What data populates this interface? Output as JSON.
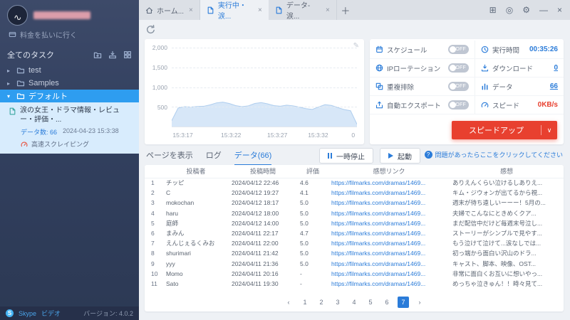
{
  "colors": {
    "accent": "#2b7cd9",
    "danger": "#e8402f",
    "chart_fill": "#d7e7f8",
    "chart_stroke": "#aecdee"
  },
  "icons": {
    "close": "×",
    "plus": "＋",
    "chevron_right": "▸",
    "chevron_down": "▾",
    "edit": "✎",
    "dropdown": "∨",
    "grid": "⊞",
    "circle": "◎",
    "gear": "⚙",
    "minimize": "—",
    "window_close": "×",
    "question": "?"
  },
  "sidebar": {
    "pay_link": "料金を払いに行く",
    "all_tasks_label": "全てのタスク",
    "folders": [
      {
        "label": "test"
      },
      {
        "label": "Samples"
      },
      {
        "label": "デフォルト"
      }
    ],
    "task": {
      "title": "涙の女王・ドラマ情報・レビュー・評価・...",
      "meta_count": "データ数: 66",
      "meta_time": "2024-04-23 15:3:38",
      "mode": "高速スクレイピング"
    },
    "footer": {
      "skype": "Skype",
      "video": "ビデオ",
      "version": "バージョン: 4.0.2"
    }
  },
  "tabs": {
    "items": [
      {
        "label": "ホーム..."
      },
      {
        "label": "実行中・涙..."
      },
      {
        "label": "データ-涙..."
      }
    ]
  },
  "stats": {
    "rows": [
      {
        "label": "スケジュール",
        "toggle": "OFF",
        "metric": "実行時間",
        "value": "00:35:26"
      },
      {
        "label": "IPローテーション",
        "toggle": "OFF",
        "metric": "ダウンロード",
        "value": "0"
      },
      {
        "label": "重複排除",
        "toggle": "OFF",
        "metric": "データ",
        "value": "66"
      },
      {
        "label": "自動エクスポート",
        "toggle": "OFF",
        "metric": "スピード",
        "value": "0KB/s"
      }
    ],
    "speedup_label": "スピードアップ"
  },
  "subtabs": {
    "items": [
      {
        "label": "ページを表示"
      },
      {
        "label": "ログ"
      },
      {
        "label": "データ(66)"
      }
    ]
  },
  "runbar": {
    "pause_label": "一時停止",
    "start_label": "起動"
  },
  "help": {
    "text": "問題があったらここをクリックしてください"
  },
  "table": {
    "headers": [
      "投稿者",
      "投稿時間",
      "評価",
      "感想リンク",
      "感想"
    ],
    "rows": [
      {
        "index": "1",
        "author": "チッピ",
        "time": "2024/04/12 22:46",
        "rating": "4.6",
        "link": "https://filmarks.com/dramas/1469...",
        "comment": "ありえんくらい泣けるしありえ..."
      },
      {
        "index": "2",
        "author": "C",
        "time": "2024/04/12 19:27",
        "rating": "4.1",
        "link": "https://filmarks.com/dramas/1469...",
        "comment": "キム・ジウォンが出てるから視..."
      },
      {
        "index": "3",
        "author": "mokochan",
        "time": "2024/04/12 18:17",
        "rating": "5.0",
        "link": "https://filmarks.com/dramas/1469...",
        "comment": "週末が待ち遠しいーーー！5月の..."
      },
      {
        "index": "4",
        "author": "haru",
        "time": "2024/04/12 18:00",
        "rating": "5.0",
        "link": "https://filmarks.com/dramas/1469...",
        "comment": "夫婦でこんなにときめくクア..."
      },
      {
        "index": "5",
        "author": "庭師",
        "time": "2024/04/12 14:00",
        "rating": "5.0",
        "link": "https://filmarks.com/dramas/1469...",
        "comment": "まだ配信中だけど毎週末号泣し..."
      },
      {
        "index": "6",
        "author": "まみん",
        "time": "2024/04/11 22:17",
        "rating": "4.7",
        "link": "https://filmarks.com/dramas/1469...",
        "comment": "ストーリーがシンプルで見やす..."
      },
      {
        "index": "7",
        "author": "えんじぇるくみお",
        "time": "2024/04/11 22:00",
        "rating": "5.0",
        "link": "https://filmarks.com/dramas/1469...",
        "comment": "もう泣けて泣けて...涙なしでは..."
      },
      {
        "index": "8",
        "author": "shurimari",
        "time": "2024/04/11 21:42",
        "rating": "5.0",
        "link": "https://filmarks.com/dramas/1469...",
        "comment": "初っ端から面白い沢山のドラ..."
      },
      {
        "index": "9",
        "author": "yyy",
        "time": "2024/04/11 21:36",
        "rating": "5.0",
        "link": "https://filmarks.com/dramas/1469...",
        "comment": "キャスト、脚本、映像、OST..."
      },
      {
        "index": "10",
        "author": "Momo",
        "time": "2024/04/11 20:16",
        "rating": "-",
        "link": "https://filmarks.com/dramas/1469...",
        "comment": "非常に面白くお互いに想いやっ..."
      },
      {
        "index": "11",
        "author": "Sato",
        "time": "2024/04/11 19:30",
        "rating": "-",
        "link": "https://filmarks.com/dramas/1469...",
        "comment": "めっちゃ泣きゅん！！時々見て..."
      }
    ]
  },
  "pagination": {
    "prev": "‹",
    "pages": [
      "1",
      "2",
      "3",
      "4",
      "5",
      "6",
      "7"
    ],
    "active": "7",
    "next": "›"
  },
  "chart_data": {
    "type": "area",
    "title": "",
    "ylim": [
      0,
      2000
    ],
    "y_labels": [
      {
        "text": "2,000",
        "pct": 0
      },
      {
        "text": "1,500",
        "pct": 25
      },
      {
        "text": "1,000",
        "pct": 50
      },
      {
        "text": "500",
        "pct": 75
      }
    ],
    "x_labels": [
      {
        "text": "15:3:17",
        "pct": 6
      },
      {
        "text": "15:3:22",
        "pct": 32
      },
      {
        "text": "15:3:27",
        "pct": 57
      },
      {
        "text": "15:3:32",
        "pct": 79
      },
      {
        "text": "0",
        "pct": 98
      }
    ],
    "values": [
      150,
      470,
      505,
      495,
      510,
      515,
      550,
      600,
      618,
      585,
      532,
      505,
      526,
      586,
      608,
      576,
      532,
      516,
      542,
      526,
      492,
      456,
      436,
      496,
      556,
      536,
      482,
      432,
      402,
      60
    ]
  }
}
